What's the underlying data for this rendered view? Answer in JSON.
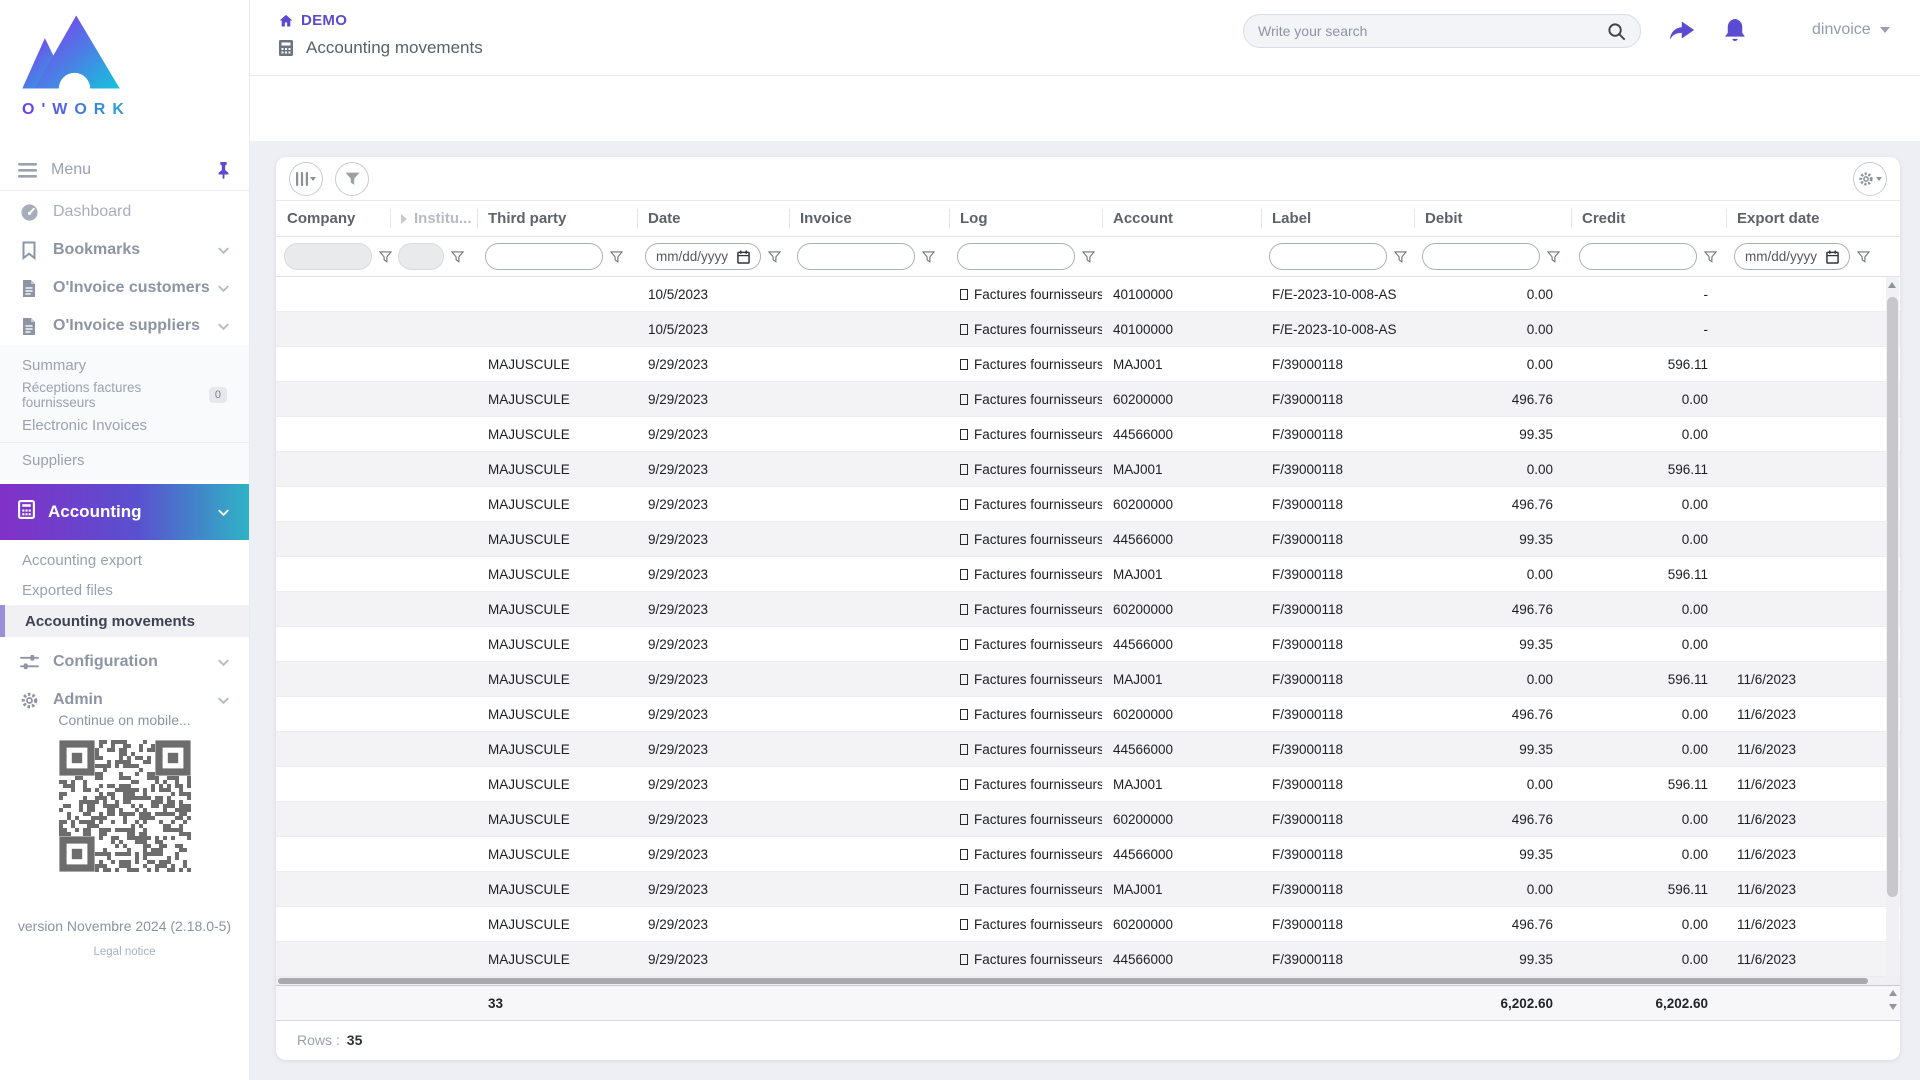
{
  "brand": {
    "name": "O'WORK"
  },
  "header": {
    "breadcrumb_root": "DEMO",
    "page_title": "Accounting movements",
    "search_placeholder": "Write your search",
    "user": "dinvoice"
  },
  "sidebar": {
    "menu_label": "Menu",
    "items": [
      {
        "label": "Dashboard"
      },
      {
        "label": "Bookmarks"
      },
      {
        "label": "O'Invoice customers"
      },
      {
        "label": "O'Invoice suppliers"
      },
      {
        "label": "Summary"
      },
      {
        "label": "Réceptions factures fournisseurs",
        "badge": "0"
      },
      {
        "label": "Electronic Invoices"
      },
      {
        "label": "Suppliers"
      },
      {
        "label": "Accounting"
      },
      {
        "label": "Accounting export"
      },
      {
        "label": "Exported files"
      },
      {
        "label": "Accounting movements"
      },
      {
        "label": "Configuration"
      },
      {
        "label": "Admin"
      }
    ],
    "mobile_hint": "Continue on mobile...",
    "version": "version Novembre 2024 (2.18.0-5)",
    "legal": "Legal notice"
  },
  "table": {
    "columns": [
      {
        "label": "Company"
      },
      {
        "label": "Institu..."
      },
      {
        "label": "Third party"
      },
      {
        "label": "Date"
      },
      {
        "label": "Invoice"
      },
      {
        "label": "Log"
      },
      {
        "label": "Account"
      },
      {
        "label": "Label"
      },
      {
        "label": "Debit"
      },
      {
        "label": "Credit"
      },
      {
        "label": "Export date"
      }
    ],
    "filters": {
      "date_placeholder": "mm/dd/yyyy",
      "export_date_placeholder": "mm/dd/yyyy"
    },
    "rows": [
      {
        "company": "",
        "institution": "",
        "third_party": "",
        "date": "10/5/2023",
        "invoice": "",
        "log": "Factures fournisseurs",
        "account": "40100000",
        "label": "F/E-2023-10-008-AS",
        "debit": "0.00",
        "credit": "-",
        "export_date": ""
      },
      {
        "company": "",
        "institution": "",
        "third_party": "",
        "date": "10/5/2023",
        "invoice": "",
        "log": "Factures fournisseurs",
        "account": "40100000",
        "label": "F/E-2023-10-008-AS",
        "debit": "0.00",
        "credit": "-",
        "export_date": ""
      },
      {
        "company": "",
        "institution": "",
        "third_party": "MAJUSCULE",
        "date": "9/29/2023",
        "invoice": "",
        "log": "Factures fournisseurs",
        "account": "MAJ001",
        "label": "F/39000118",
        "debit": "0.00",
        "credit": "596.11",
        "export_date": ""
      },
      {
        "company": "",
        "institution": "",
        "third_party": "MAJUSCULE",
        "date": "9/29/2023",
        "invoice": "",
        "log": "Factures fournisseurs",
        "account": "60200000",
        "label": "F/39000118",
        "debit": "496.76",
        "credit": "0.00",
        "export_date": ""
      },
      {
        "company": "",
        "institution": "",
        "third_party": "MAJUSCULE",
        "date": "9/29/2023",
        "invoice": "",
        "log": "Factures fournisseurs",
        "account": "44566000",
        "label": "F/39000118",
        "debit": "99.35",
        "credit": "0.00",
        "export_date": ""
      },
      {
        "company": "",
        "institution": "",
        "third_party": "MAJUSCULE",
        "date": "9/29/2023",
        "invoice": "",
        "log": "Factures fournisseurs",
        "account": "MAJ001",
        "label": "F/39000118",
        "debit": "0.00",
        "credit": "596.11",
        "export_date": ""
      },
      {
        "company": "",
        "institution": "",
        "third_party": "MAJUSCULE",
        "date": "9/29/2023",
        "invoice": "",
        "log": "Factures fournisseurs",
        "account": "60200000",
        "label": "F/39000118",
        "debit": "496.76",
        "credit": "0.00",
        "export_date": ""
      },
      {
        "company": "",
        "institution": "",
        "third_party": "MAJUSCULE",
        "date": "9/29/2023",
        "invoice": "",
        "log": "Factures fournisseurs",
        "account": "44566000",
        "label": "F/39000118",
        "debit": "99.35",
        "credit": "0.00",
        "export_date": ""
      },
      {
        "company": "",
        "institution": "",
        "third_party": "MAJUSCULE",
        "date": "9/29/2023",
        "invoice": "",
        "log": "Factures fournisseurs",
        "account": "MAJ001",
        "label": "F/39000118",
        "debit": "0.00",
        "credit": "596.11",
        "export_date": ""
      },
      {
        "company": "",
        "institution": "",
        "third_party": "MAJUSCULE",
        "date": "9/29/2023",
        "invoice": "",
        "log": "Factures fournisseurs",
        "account": "60200000",
        "label": "F/39000118",
        "debit": "496.76",
        "credit": "0.00",
        "export_date": ""
      },
      {
        "company": "",
        "institution": "",
        "third_party": "MAJUSCULE",
        "date": "9/29/2023",
        "invoice": "",
        "log": "Factures fournisseurs",
        "account": "44566000",
        "label": "F/39000118",
        "debit": "99.35",
        "credit": "0.00",
        "export_date": ""
      },
      {
        "company": "",
        "institution": "",
        "third_party": "MAJUSCULE",
        "date": "9/29/2023",
        "invoice": "",
        "log": "Factures fournisseurs",
        "account": "MAJ001",
        "label": "F/39000118",
        "debit": "0.00",
        "credit": "596.11",
        "export_date": "11/6/2023"
      },
      {
        "company": "",
        "institution": "",
        "third_party": "MAJUSCULE",
        "date": "9/29/2023",
        "invoice": "",
        "log": "Factures fournisseurs",
        "account": "60200000",
        "label": "F/39000118",
        "debit": "496.76",
        "credit": "0.00",
        "export_date": "11/6/2023"
      },
      {
        "company": "",
        "institution": "",
        "third_party": "MAJUSCULE",
        "date": "9/29/2023",
        "invoice": "",
        "log": "Factures fournisseurs",
        "account": "44566000",
        "label": "F/39000118",
        "debit": "99.35",
        "credit": "0.00",
        "export_date": "11/6/2023"
      },
      {
        "company": "",
        "institution": "",
        "third_party": "MAJUSCULE",
        "date": "9/29/2023",
        "invoice": "",
        "log": "Factures fournisseurs",
        "account": "MAJ001",
        "label": "F/39000118",
        "debit": "0.00",
        "credit": "596.11",
        "export_date": "11/6/2023"
      },
      {
        "company": "",
        "institution": "",
        "third_party": "MAJUSCULE",
        "date": "9/29/2023",
        "invoice": "",
        "log": "Factures fournisseurs",
        "account": "60200000",
        "label": "F/39000118",
        "debit": "496.76",
        "credit": "0.00",
        "export_date": "11/6/2023"
      },
      {
        "company": "",
        "institution": "",
        "third_party": "MAJUSCULE",
        "date": "9/29/2023",
        "invoice": "",
        "log": "Factures fournisseurs",
        "account": "44566000",
        "label": "F/39000118",
        "debit": "99.35",
        "credit": "0.00",
        "export_date": "11/6/2023"
      },
      {
        "company": "",
        "institution": "",
        "third_party": "MAJUSCULE",
        "date": "9/29/2023",
        "invoice": "",
        "log": "Factures fournisseurs",
        "account": "MAJ001",
        "label": "F/39000118",
        "debit": "0.00",
        "credit": "596.11",
        "export_date": "11/6/2023"
      },
      {
        "company": "",
        "institution": "",
        "third_party": "MAJUSCULE",
        "date": "9/29/2023",
        "invoice": "",
        "log": "Factures fournisseurs",
        "account": "60200000",
        "label": "F/39000118",
        "debit": "496.76",
        "credit": "0.00",
        "export_date": "11/6/2023"
      },
      {
        "company": "",
        "institution": "",
        "third_party": "MAJUSCULE",
        "date": "9/29/2023",
        "invoice": "",
        "log": "Factures fournisseurs",
        "account": "44566000",
        "label": "F/39000118",
        "debit": "99.35",
        "credit": "0.00",
        "export_date": "11/6/2023"
      }
    ],
    "totals": {
      "count": "33",
      "debit": "6,202.60",
      "credit": "6,202.60"
    },
    "footer": {
      "rows_label": "Rows :",
      "rows_value": "35"
    }
  }
}
